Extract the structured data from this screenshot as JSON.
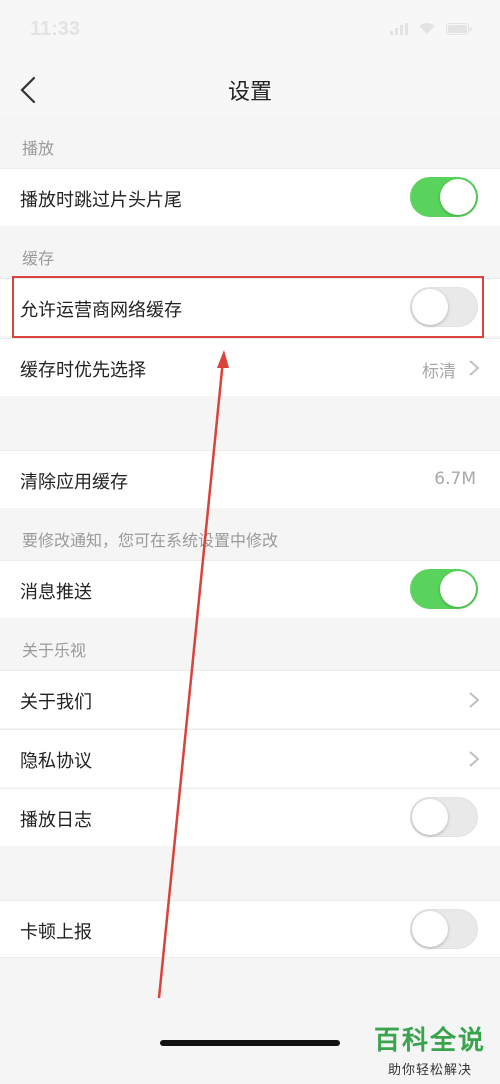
{
  "status_bar": {
    "time": "11:33"
  },
  "nav": {
    "title": "设置"
  },
  "sections": {
    "playback": "播放",
    "cache": "缓存",
    "notify": "要修改通知，您可在系统设置中修改",
    "about": "关于乐视"
  },
  "rows": {
    "skip_intro": {
      "label": "播放时跳过片头片尾",
      "toggle_on": true
    },
    "carrier_cache": {
      "label": "允许运营商网络缓存",
      "toggle_on": false
    },
    "cache_quality": {
      "label": "缓存时优先选择",
      "value": "标清"
    },
    "clear_cache": {
      "label": "清除应用缓存",
      "value": "6.7M"
    },
    "push": {
      "label": "消息推送",
      "toggle_on": true
    },
    "about_us": {
      "label": "关于我们"
    },
    "privacy": {
      "label": "隐私协议"
    },
    "play_log": {
      "label": "播放日志",
      "toggle_on": false
    },
    "lag_report": {
      "label": "卡顿上报",
      "toggle_on": false
    }
  },
  "colors": {
    "toggle_on": "#5ad35c",
    "toggle_off": "#e9e9e9",
    "highlight": "#d9433c"
  },
  "watermark": {
    "title": "百科全说",
    "subtitle": "助你轻松解决"
  }
}
